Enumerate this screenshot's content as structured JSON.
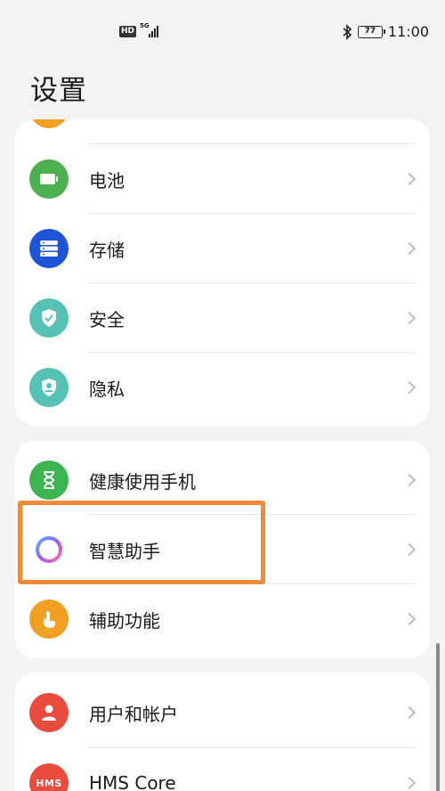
{
  "status_bar": {
    "hd": "HD",
    "network": "5G",
    "battery": "77",
    "time": "11:00"
  },
  "page": {
    "title": "设置"
  },
  "cards": [
    {
      "items": [
        {
          "label": "电池",
          "icon": "battery-icon",
          "color": "#4caf50"
        },
        {
          "label": "存储",
          "icon": "storage-icon",
          "color": "#1e55d8"
        },
        {
          "label": "安全",
          "icon": "shield-icon",
          "color": "#56c2b3"
        },
        {
          "label": "隐私",
          "icon": "privacy-icon",
          "color": "#56c2b3"
        }
      ]
    },
    {
      "items": [
        {
          "label": "健康使用手机",
          "icon": "hourglass-icon",
          "color": "#3cb550"
        },
        {
          "label": "智慧助手",
          "icon": "assistant-icon",
          "color": "#8a66e8"
        },
        {
          "label": "辅助功能",
          "icon": "hand-icon",
          "color": "#f2a024"
        }
      ]
    },
    {
      "items": [
        {
          "label": "用户和帐户",
          "icon": "user-icon",
          "color": "#e94b3c"
        },
        {
          "label": "HMS Core",
          "icon": "hms-icon",
          "color": "#e94b3c",
          "icon_text": "HMS"
        }
      ]
    }
  ],
  "accent": {
    "highlight": "#f08b3a",
    "partial_top_icon": "#f2a024"
  }
}
